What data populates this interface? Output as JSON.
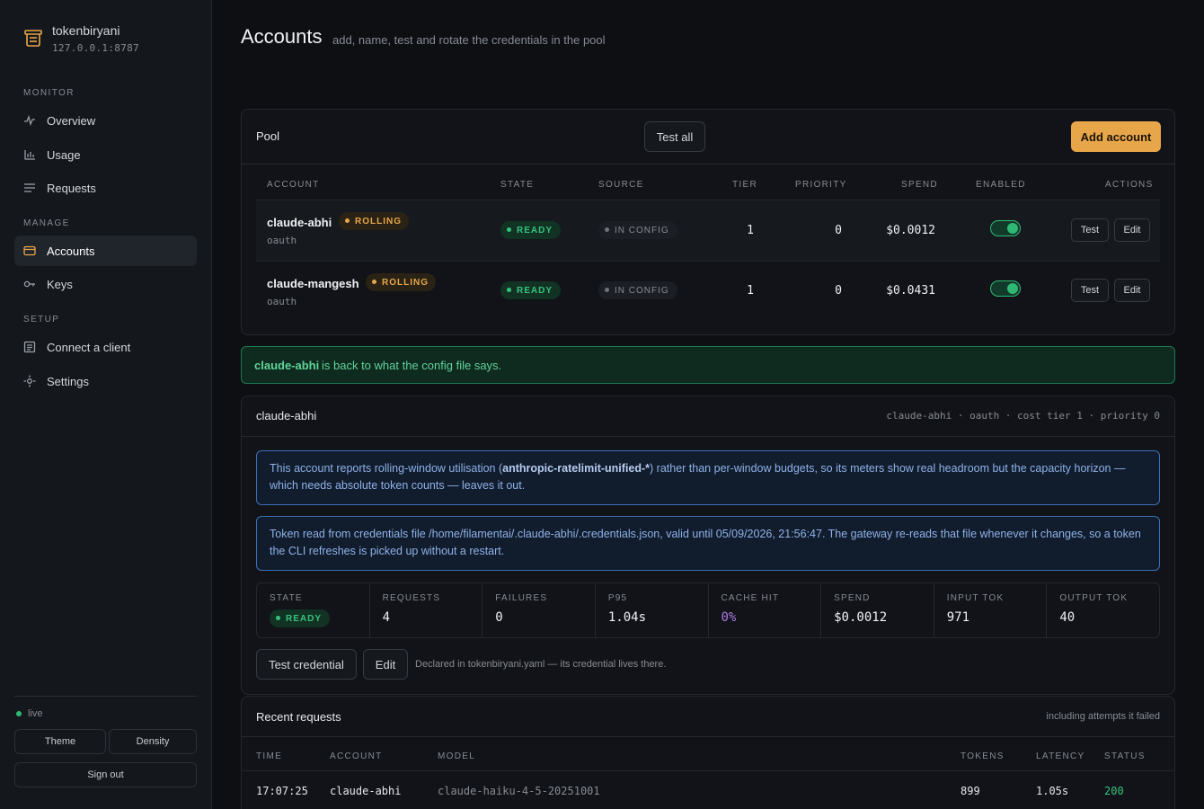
{
  "app": {
    "name": "tokenbiryani",
    "host": "127.0.0.1:8787"
  },
  "sidebar": {
    "sections": {
      "monitor": "MONITOR",
      "manage": "MANAGE",
      "setup": "SETUP"
    },
    "items": {
      "overview": "Overview",
      "usage": "Usage",
      "requests": "Requests",
      "accounts": "Accounts",
      "keys": "Keys",
      "connect": "Connect a client",
      "settings": "Settings"
    },
    "status": "live",
    "theme": "Theme",
    "density": "Density",
    "signout": "Sign out"
  },
  "page": {
    "title": "Accounts",
    "subtitle": "add, name, test and rotate the credentials in the pool"
  },
  "pool": {
    "title": "Pool",
    "test_all": "Test all",
    "add_account": "Add account",
    "columns": [
      "ACCOUNT",
      "STATE",
      "SOURCE",
      "TIER",
      "PRIORITY",
      "SPEND",
      "ENABLED",
      "ACTIONS"
    ],
    "rows": [
      {
        "name": "claude-abhi",
        "badge": "ROLLING",
        "kind": "oauth",
        "state": "READY",
        "source": "IN CONFIG",
        "tier": "1",
        "priority": "0",
        "spend": "$0.0012",
        "enabled": true,
        "test": "Test",
        "edit": "Edit"
      },
      {
        "name": "claude-mangesh",
        "badge": "ROLLING",
        "kind": "oauth",
        "state": "READY",
        "source": "IN CONFIG",
        "tier": "1",
        "priority": "0",
        "spend": "$0.0431",
        "enabled": true,
        "test": "Test",
        "edit": "Edit"
      }
    ]
  },
  "notice": {
    "account": "claude-abhi",
    "message": "is back to what the config file says."
  },
  "detail": {
    "title": "claude-abhi",
    "meta": "claude-abhi · oauth · cost tier 1 · priority 0",
    "info1": {
      "before": "This account reports rolling-window utilisation (",
      "strong": "anthropic-ratelimit-unified-*",
      "after": ") rather than per-window budgets, so its meters show real headroom but the capacity horizon — which needs absolute token counts — leaves it out."
    },
    "info2": "Token read from credentials file /home/filamentai/.claude-abhi/.credentials.json, valid until 05/09/2026, 21:56:47. The gateway re-reads that file whenever it changes, so a token the CLI refreshes is picked up without a restart.",
    "stats": {
      "state": {
        "label": "STATE",
        "value": "READY"
      },
      "requests": {
        "label": "REQUESTS",
        "value": "4"
      },
      "failures": {
        "label": "FAILURES",
        "value": "0"
      },
      "p95": {
        "label": "P95",
        "value": "1.04s"
      },
      "cache": {
        "label": "CACHE HIT",
        "value": "0%"
      },
      "spend": {
        "label": "SPEND",
        "value": "$0.0012"
      },
      "input": {
        "label": "INPUT TOK",
        "value": "971"
      },
      "output": {
        "label": "OUTPUT TOK",
        "value": "40"
      }
    },
    "test_credential": "Test credential",
    "edit": "Edit",
    "declared": "Declared in tokenbiryani.yaml — its credential lives there."
  },
  "recent": {
    "title": "Recent requests",
    "hint": "including attempts it failed",
    "columns": [
      "TIME",
      "ACCOUNT",
      "MODEL",
      "TOKENS",
      "LATENCY",
      "STATUS"
    ],
    "rows": [
      {
        "time": "17:07:25",
        "account": "claude-abhi",
        "model": "claude-haiku-4-5-20251001",
        "tokens": "899",
        "latency": "1.05s",
        "status": "200"
      }
    ]
  },
  "colors": {
    "accent": "#e8a64a",
    "success": "#36c27e",
    "info": "#3d6fb8",
    "cache": "#b07ce8"
  }
}
